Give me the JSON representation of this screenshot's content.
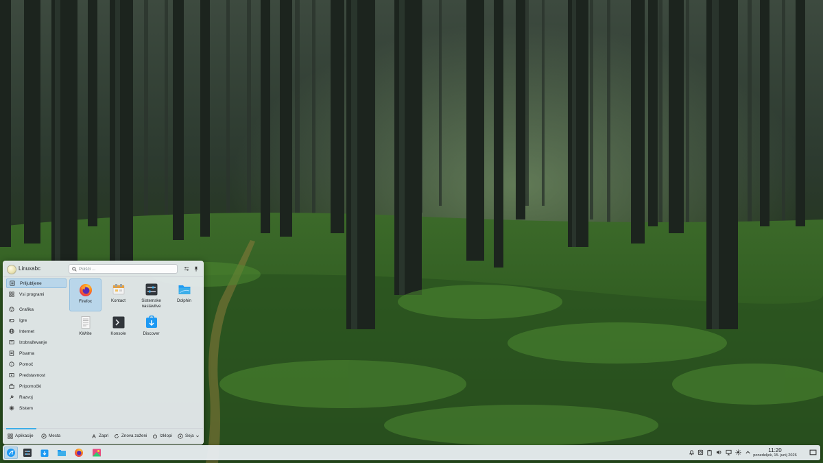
{
  "launcher": {
    "username": "Linuxabc",
    "search_placeholder": "Poišči ...",
    "sidebar": [
      {
        "label": "Priljubljene",
        "icon": "star-icon"
      },
      {
        "label": "Vsi programi",
        "icon": "grid-icon"
      },
      {
        "label": "Grafika",
        "icon": "graphics-icon"
      },
      {
        "label": "Igre",
        "icon": "gamepad-icon"
      },
      {
        "label": "Internet",
        "icon": "globe-icon"
      },
      {
        "label": "Izobraževanje",
        "icon": "education-icon"
      },
      {
        "label": "Pisarna",
        "icon": "office-icon"
      },
      {
        "label": "Pomoč",
        "icon": "help-icon"
      },
      {
        "label": "Predstavnost",
        "icon": "multimedia-icon"
      },
      {
        "label": "Pripomočki",
        "icon": "utilities-icon"
      },
      {
        "label": "Razvoj",
        "icon": "development-icon"
      },
      {
        "label": "Sistem",
        "icon": "system-icon"
      }
    ],
    "apps": [
      {
        "label": "Firefox",
        "icon": "firefox-icon"
      },
      {
        "label": "Kontact",
        "icon": "kontact-icon"
      },
      {
        "label": "Sistemske nastavitve",
        "icon": "settings-icon"
      },
      {
        "label": "Dolphin",
        "icon": "dolphin-folder-icon"
      },
      {
        "label": "KWrite",
        "icon": "kwrite-icon"
      },
      {
        "label": "Konsole",
        "icon": "konsole-icon"
      },
      {
        "label": "Discover",
        "icon": "discover-icon"
      }
    ],
    "footer": {
      "tab_apps": "Aplikacije",
      "tab_places": "Mesta",
      "lock": "Zapri",
      "restart": "Znova zaženi",
      "shutdown": "Izklopi",
      "session": "Seja"
    }
  },
  "taskbar": {
    "apps": [
      "kde-launcher-icon",
      "system-settings-icon",
      "discover-icon",
      "dolphin-icon",
      "firefox-icon",
      "spectacle-icon"
    ],
    "clock": {
      "time": "11:20",
      "date": "ponedeljek, 15. junij 2026"
    }
  },
  "colors": {
    "accent": "#3daee9",
    "selection": "#b9d6ea",
    "panel": "#e9eef2"
  }
}
